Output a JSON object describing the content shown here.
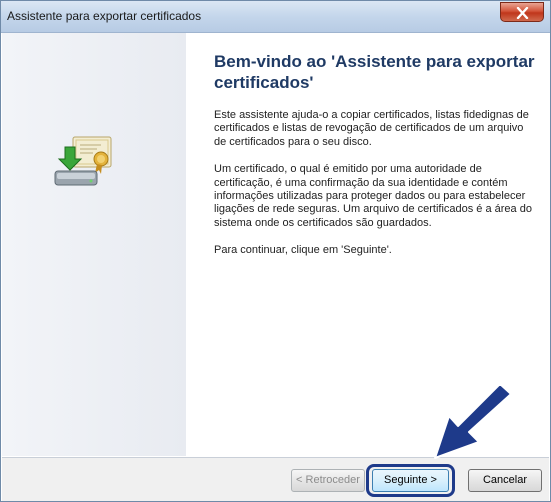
{
  "window": {
    "title": "Assistente para exportar certificados",
    "close_symbol": "✕"
  },
  "main": {
    "heading": "Bem-vindo ao 'Assistente para exportar certificados'",
    "paragraphs": [
      "Este assistente ajuda-o a copiar certificados, listas fidedignas de certificados e listas de revogação de certificados de um arquivo de certificados para o seu disco.",
      "Um certificado, o qual é emitido por uma autoridade de certificação, é uma confirmação da sua identidade e contém informações utilizadas para proteger dados ou para estabelecer ligações de rede seguras. Um arquivo de certificados é a área do sistema onde os certificados são guardados.",
      "Para continuar, clique em 'Seguinte'."
    ]
  },
  "footer": {
    "back_label": "< Retroceder",
    "next_label": "Seguinte >",
    "cancel_label": "Cancelar"
  },
  "icons": {
    "certificate": "certificate-export-icon",
    "arrow": "pointer-arrow-icon"
  },
  "colors": {
    "heading": "#1f3a64",
    "arrow": "#1e3a8a",
    "highlight": "#1e3a8a",
    "close_button": "#c0361b"
  }
}
